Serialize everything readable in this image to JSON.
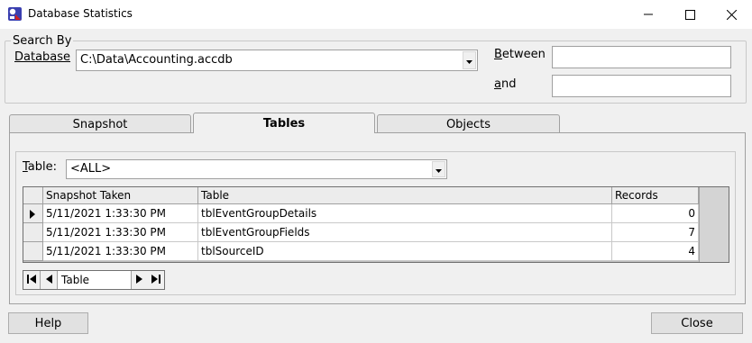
{
  "window": {
    "title": "Database Statistics"
  },
  "search_by": {
    "legend": "Search By",
    "database_label": "Database",
    "database_value": "C:\\Data\\Accounting.accdb",
    "between_label": "Between",
    "between_value": "",
    "and_label": "and",
    "and_value": ""
  },
  "tabs": [
    {
      "label": "Snapshot",
      "active": false
    },
    {
      "label": "Tables",
      "active": true
    },
    {
      "label": "Objects",
      "active": false
    }
  ],
  "tables_tab": {
    "table_label": "Table:",
    "table_value": "<ALL>",
    "grid": {
      "columns": [
        "Snapshot Taken",
        "Table",
        "Records"
      ],
      "rows": [
        {
          "snapshot_taken": "5/11/2021 1:33:30 PM",
          "table": "tblEventGroupDetails",
          "records": "0",
          "current": true
        },
        {
          "snapshot_taken": "5/11/2021 1:33:30 PM",
          "table": "tblEventGroupFields",
          "records": "7",
          "current": false
        },
        {
          "snapshot_taken": "5/11/2021 1:33:30 PM",
          "table": "tblSourceID",
          "records": "4",
          "current": false
        }
      ]
    },
    "navigator": {
      "label": "Table"
    }
  },
  "buttons": {
    "help": "Help",
    "close": "Close"
  },
  "icons": {
    "app": "database-app-icon",
    "minimize": "minimize-icon",
    "maximize": "maximize-icon",
    "close": "close-icon"
  }
}
